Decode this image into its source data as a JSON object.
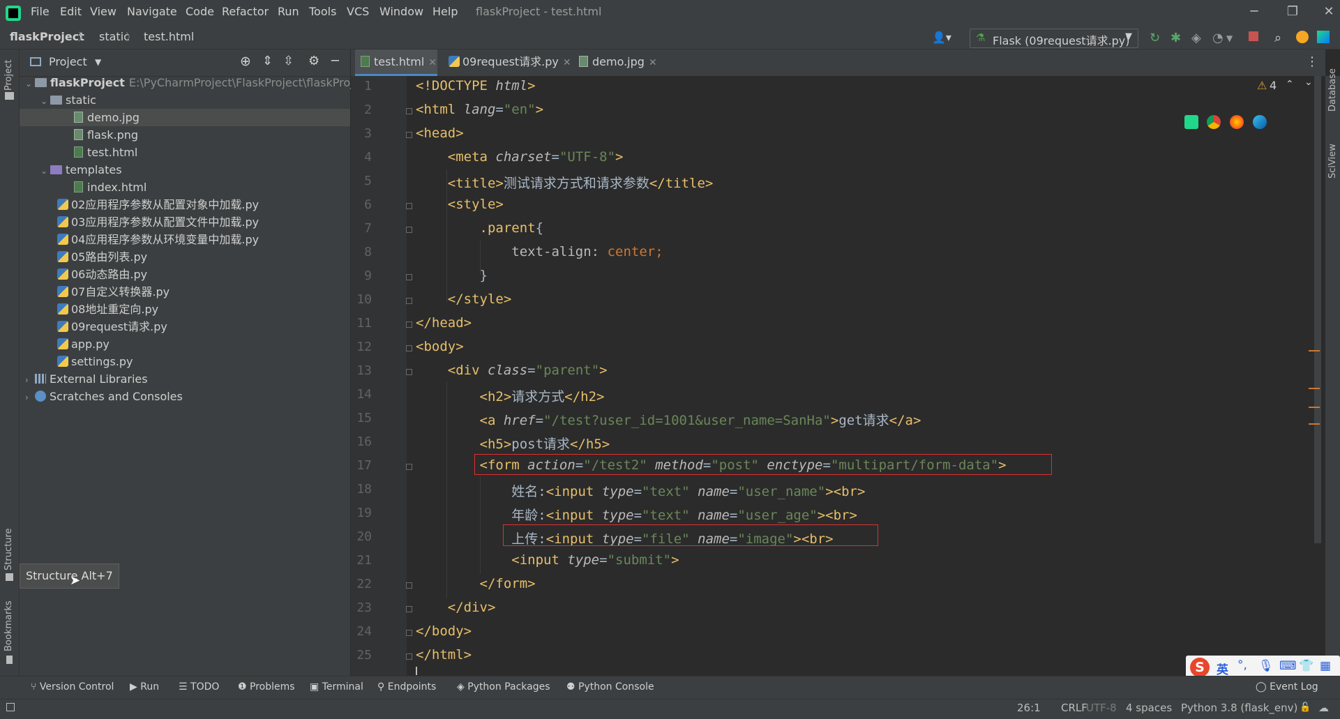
{
  "menubar": {
    "items": [
      "File",
      "Edit",
      "View",
      "Navigate",
      "Code",
      "Refactor",
      "Run",
      "Tools",
      "VCS",
      "Window",
      "Help"
    ],
    "window_title": "flaskProject - test.html"
  },
  "breadcrumb": [
    "flaskProject",
    "static",
    "test.html"
  ],
  "run_config": "Flask (09request请求.py)",
  "project_panel": {
    "title": "Project",
    "root": {
      "name": "flaskProject",
      "path": "E:\\PyCharmProject\\FlaskProject\\flaskProject"
    },
    "tree": [
      {
        "label": "static"
      },
      {
        "label": "demo.jpg"
      },
      {
        "label": "flask.png"
      },
      {
        "label": "test.html"
      },
      {
        "label": "templates"
      },
      {
        "label": "index.html"
      },
      {
        "label": "02应用程序参数从配置对象中加载.py"
      },
      {
        "label": "03应用程序参数从配置文件中加载.py"
      },
      {
        "label": "04应用程序参数从环境变量中加载.py"
      },
      {
        "label": "05路由列表.py"
      },
      {
        "label": "06动态路由.py"
      },
      {
        "label": "07自定义转换器.py"
      },
      {
        "label": "08地址重定向.py"
      },
      {
        "label": "09request请求.py"
      },
      {
        "label": "app.py"
      },
      {
        "label": "settings.py"
      },
      {
        "label": "External Libraries"
      },
      {
        "label": "Scratches and Consoles"
      }
    ]
  },
  "tooltip": "Structure  Alt+7",
  "left_strip": {
    "project": "Project",
    "structure": "Structure",
    "bookmarks": "Bookmarks"
  },
  "right_strip": {
    "database": "Database",
    "sciview": "SciView"
  },
  "editor_tabs": [
    "test.html",
    "09request请求.py",
    "demo.jpg"
  ],
  "inspections": {
    "warnings": "4"
  },
  "code_lines": [
    "1",
    "2",
    "3",
    "4",
    "5",
    "6",
    "7",
    "8",
    "9",
    "10",
    "11",
    "12",
    "13",
    "14",
    "15",
    "16",
    "17",
    "18",
    "19",
    "20",
    "21",
    "22",
    "23",
    "24",
    "25"
  ],
  "code_text": {
    "l1": [
      "<!DOCTYPE ",
      "html",
      ">"
    ],
    "l2": [
      "<html ",
      "lang",
      "=",
      "\"en\"",
      ">"
    ],
    "l3": "<head>",
    "l4": [
      "<meta ",
      "charset",
      "=",
      "\"UTF-8\"",
      ">"
    ],
    "l5": [
      "<title>",
      "测试请求方式和请求参数",
      "</title>"
    ],
    "l6": "<style>",
    "l7": [
      ".parent",
      "{"
    ],
    "l8": [
      "text-align",
      ": ",
      "center",
      ";"
    ],
    "l9": "}",
    "l10": "</style>",
    "l11": "</head>",
    "l12": "<body>",
    "l13": [
      "<div ",
      "class",
      "=",
      "\"parent\"",
      ">"
    ],
    "l14": [
      "<h2>",
      "请求方式",
      "</h2>"
    ],
    "l15": [
      "<a ",
      "href",
      "=",
      "\"/test?user_id=1001&user_name=SanHa\"",
      ">",
      "get请求",
      "</a>"
    ],
    "l16": [
      "<h5>",
      "post请求",
      "</h5>"
    ],
    "l17": [
      "<form ",
      "action",
      "=",
      "\"/test2\"",
      "method",
      "=",
      "\"post\"",
      "enctype",
      "=",
      "\"multipart/form-data\"",
      ">"
    ],
    "l18": [
      "姓名:",
      "<input ",
      "type",
      "=",
      "\"text\"",
      "name",
      "=",
      "\"user_name\"",
      "><br>"
    ],
    "l19": [
      "年龄:",
      "<input ",
      "type",
      "=",
      "\"text\"",
      "name",
      "=",
      "\"user_age\"",
      "><br>"
    ],
    "l20": [
      "上传:",
      "<input ",
      "type",
      "=",
      "\"file\"",
      "name",
      "=",
      "\"image\"",
      "><br>"
    ],
    "l21": [
      "<input ",
      "type",
      "=",
      "\"submit\"",
      ">"
    ],
    "l22": "</form>",
    "l23": "</div>",
    "l24": "</body>",
    "l25": "</html>"
  },
  "bottom_tools": [
    "Version Control",
    "Run",
    "TODO",
    "Problems",
    "Terminal",
    "Endpoints",
    "Python Packages",
    "Python Console",
    "Event Log"
  ],
  "ime": {
    "lang": "英"
  },
  "status": {
    "position": "26:1",
    "line_sep": "CRLF",
    "encoding": "UTF-8",
    "indent": "4 spaces",
    "interpreter": "Python 3.8 (flask_env)"
  },
  "colors": {
    "accent": "#4a88c7",
    "highlight_box": "#e03030",
    "tag": "#e8bf6a",
    "string": "#6a8759"
  }
}
